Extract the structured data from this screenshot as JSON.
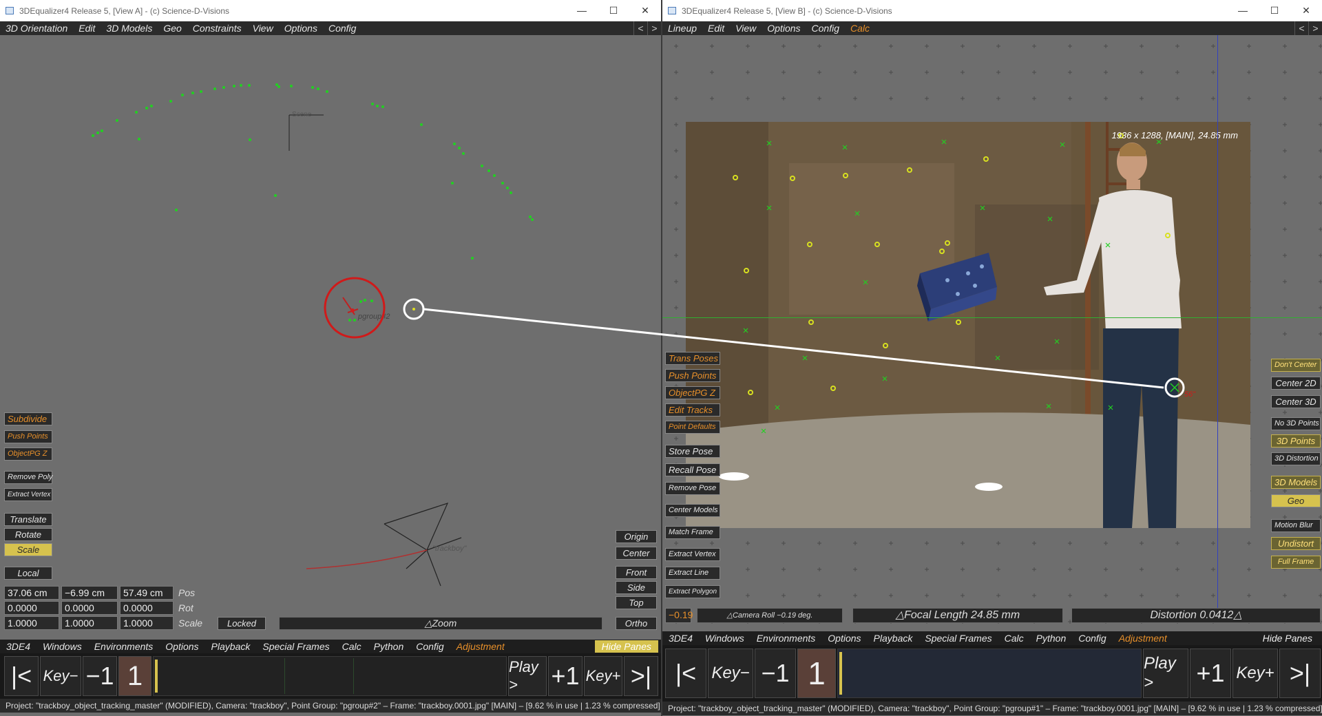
{
  "viewA": {
    "title": "3DEqualizer4 Release 5, [View A]  -  (c) Science-D-Visions",
    "menu": [
      "3D Orientation",
      "Edit",
      "3D Models",
      "Geo",
      "Constraints",
      "View",
      "Options",
      "Config"
    ],
    "nav_prev": "<",
    "nav_next": ">",
    "label_scene": "Scene",
    "label_pgroup": "pgroup#2",
    "label_trackboy": "\"trackboy\"",
    "buttons": {
      "subdivide": "Subdivide",
      "push_points": "Push Points",
      "objectpg_z": "ObjectPG Z",
      "remove_poly": "Remove Poly",
      "extract_vertex": "Extract Vertex",
      "translate": "Translate",
      "rotate": "Rotate",
      "scale": "Scale",
      "local": "Local",
      "locked": "Locked",
      "zoom": "△Zoom",
      "origin": "Origin",
      "center": "Center",
      "front": "Front",
      "side": "Side",
      "top": "Top",
      "ortho": "Ortho"
    },
    "pos": [
      "37.06 cm",
      "−6.99 cm",
      "57.49 cm"
    ],
    "rot": [
      "0.0000",
      "0.0000",
      "0.0000"
    ],
    "scl": [
      "1.0000",
      "1.0000",
      "1.0000"
    ],
    "pos_label": "Pos",
    "rot_label": "Rot",
    "scale_label": "Scale",
    "bottom_menu": [
      "3DE4",
      "Windows",
      "Environments",
      "Options",
      "Playback",
      "Special Frames",
      "Calc",
      "Python",
      "Config",
      "Adjustment"
    ],
    "hide_panes": "Hide Panes",
    "status": "Project: \"trackboy_object_tracking_master\" (MODIFIED), Camera: \"trackboy\", Point Group: \"pgroup#2\"  –  Frame: \"trackboy.0001.jpg\"  [MAIN]  –  [9.62 % in use | 1.23 % compressed]"
  },
  "viewB": {
    "title": "3DEqualizer4 Release 5, [View B]  -  (c) Science-D-Visions",
    "menu": [
      "Lineup",
      "Edit",
      "View",
      "Options",
      "Config",
      "Calc"
    ],
    "nav_prev": "<",
    "nav_next": ">",
    "image_info": "1936 x 1288, [MAIN], 24.85 mm",
    "point_label": "56\"",
    "left_buttons": {
      "trans_poses": "Trans Poses",
      "push_points": "Push Points",
      "objectpg_z": "ObjectPG Z",
      "edit_tracks": "Edit Tracks",
      "point_defaults": "Point Defaults",
      "store_pose": "Store Pose",
      "recall_pose": "Recall Pose",
      "remove_pose": "Remove Pose",
      "center_models": "Center Models",
      "match_frame": "Match Frame",
      "extract_vertex": "Extract Vertex",
      "extract_line": "Extract Line",
      "extract_polygon": "Extract Polygon"
    },
    "right_buttons": {
      "dont_center": "Don't Center",
      "center_2d": "Center 2D",
      "center_3d": "Center 3D",
      "no_3d_points": "No 3D Points",
      "points_3d": "3D Points",
      "distortion_3d": "3D Distortion",
      "models_3d": "3D Models",
      "geo": "Geo",
      "motion_blur": "Motion Blur",
      "undistort": "Undistort",
      "full_frame": "Full Frame"
    },
    "roll_value": "−0.19",
    "camera_roll": "△Camera Roll −0.19 deg.",
    "focal_length": "△Focal Length 24.85 mm",
    "distortion": "Distortion 0.0412△",
    "bottom_menu": [
      "3DE4",
      "Windows",
      "Environments",
      "Options",
      "Playback",
      "Special Frames",
      "Calc",
      "Python",
      "Config",
      "Adjustment"
    ],
    "hide_panes": "Hide Panes",
    "status": "Project: \"trackboy_object_tracking_master\" (MODIFIED), Camera: \"trackboy\", Point Group: \"pgroup#1\"  –  Frame: \"trackboy.0001.jpg\"  [MAIN]  –  [9.62 % in use | 1.23 % compressed]"
  },
  "timeline": {
    "first": "|<",
    "key_prev": "Key−",
    "minus1": "−1",
    "frame": "1",
    "play": "Play >",
    "plus1": "+1",
    "key_next": "Key+",
    "last": ">|"
  },
  "window_controls": {
    "minimize": "—",
    "maximize": "☐",
    "close": "✕"
  },
  "colors": {
    "accent_orange": "#e8902a",
    "active_yellow": "#d6c24e",
    "point_green": "#22d022",
    "point_yellow": "#d8e020",
    "select_red": "#d01a1a"
  }
}
